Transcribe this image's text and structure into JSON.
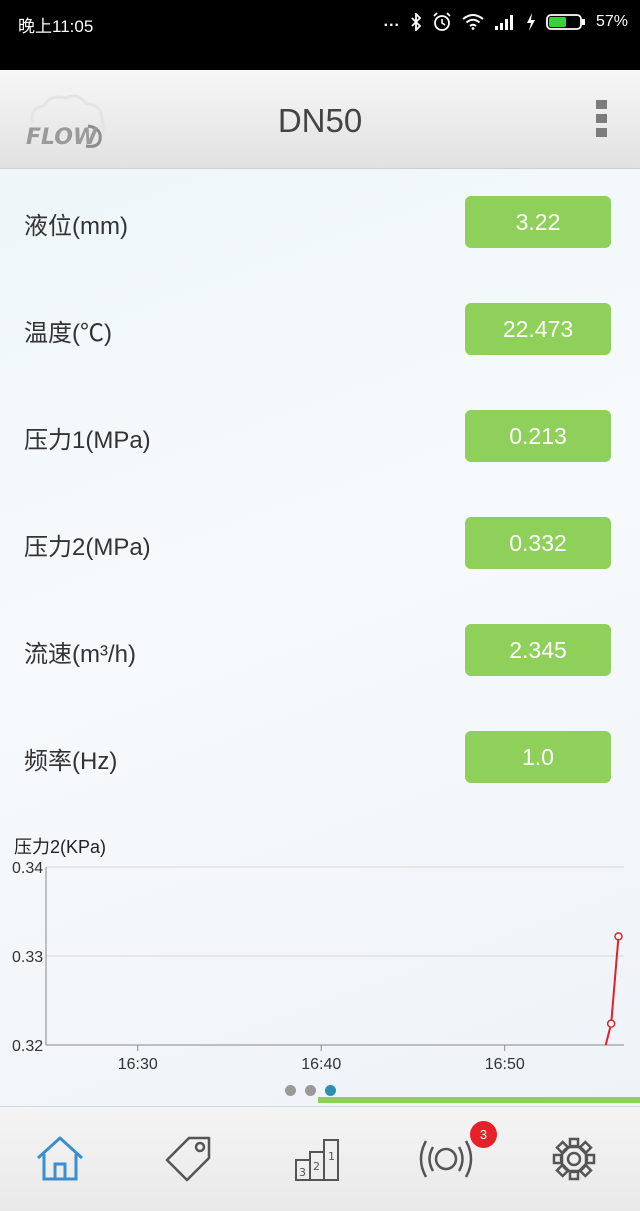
{
  "status_bar": {
    "time": "晚上11:05",
    "dots": "...",
    "battery_percent": "57%",
    "battery_level": 0.57
  },
  "header": {
    "logo_text": "FLOW",
    "title": "DN50"
  },
  "readings": [
    {
      "label": "液位(mm)",
      "value": "3.22"
    },
    {
      "label": "温度(℃)",
      "value": "22.473"
    },
    {
      "label": "压力1(MPa)",
      "value": "0.213"
    },
    {
      "label": "压力2(MPa)",
      "value": "0.332"
    },
    {
      "label": "流速(m³/h)",
      "value": "2.345"
    },
    {
      "label": "频率(Hz)",
      "value": "1.0"
    }
  ],
  "chart_data": {
    "type": "line",
    "title": "压力2(KPa)",
    "xlabel": "",
    "ylabel": "",
    "ylim": [
      0.32,
      0.34
    ],
    "yticks": [
      "0.32",
      "0.33",
      "0.34"
    ],
    "xlim": [
      "16:25",
      "16:56.5"
    ],
    "xticks": [
      "16:30",
      "16:40",
      "16:50"
    ],
    "series": [
      {
        "color": "#e0202e",
        "points": [
          {
            "x": "16:55.5",
            "y": 0.32
          },
          {
            "x": "16:55.8",
            "y": 0.3224
          },
          {
            "x": "16:56.2",
            "y": 0.3322
          }
        ]
      }
    ],
    "grid": true
  },
  "pager": {
    "count": 3,
    "active": 2
  },
  "tabs": [
    {
      "name": "home",
      "icon": "home-icon",
      "selected": true
    },
    {
      "name": "tag",
      "icon": "tag-icon"
    },
    {
      "name": "ranking",
      "icon": "podium-icon"
    },
    {
      "name": "alarm",
      "icon": "alarm-icon",
      "badge": "3"
    },
    {
      "name": "settings",
      "icon": "gear-icon"
    }
  ],
  "colors": {
    "value_box": "#8fd05a",
    "accent_blue": "#3a8fd0",
    "line_series": "#e0202e",
    "badge": "#e8202a"
  }
}
